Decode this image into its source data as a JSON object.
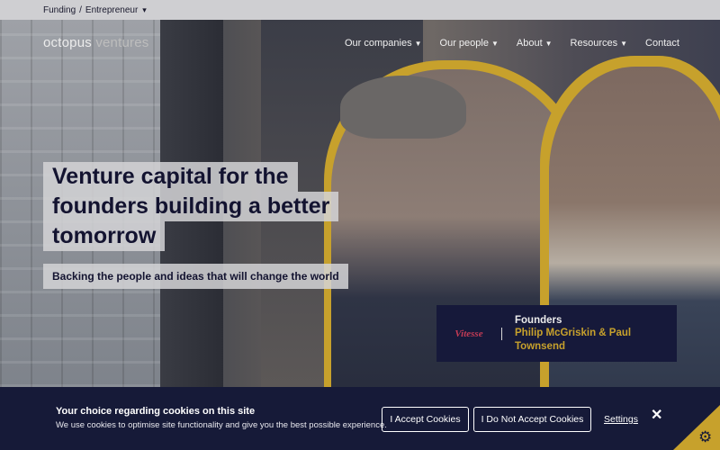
{
  "topbar": {
    "segment": "Funding",
    "separator": "/",
    "audience": "Entrepreneur",
    "chevron_icon": "chevron-down-icon"
  },
  "nav": {
    "logo_main": "octopus",
    "logo_sub": "ventures",
    "items": [
      {
        "label": "Our companies",
        "has_dropdown": true
      },
      {
        "label": "Our people",
        "has_dropdown": true
      },
      {
        "label": "About",
        "has_dropdown": true
      },
      {
        "label": "Resources",
        "has_dropdown": true
      },
      {
        "label": "Contact",
        "has_dropdown": false
      }
    ]
  },
  "hero": {
    "headline_lines": [
      "Venture capital for the",
      "founders building a better",
      "tomorrow"
    ],
    "subheadline": "Backing the people and ideas that will change the world"
  },
  "founders_card": {
    "company": "Vitesse",
    "label": "Founders",
    "names_line1": "Philip McGriskin & Paul",
    "names_line2": "Townsend"
  },
  "cookie_banner": {
    "title": "Your choice regarding cookies on this site",
    "body": "We use cookies to optimise site functionality and give you the best possible experience.",
    "accept_label": "I Accept Cookies",
    "reject_label": "I Do Not Accept Cookies",
    "settings_label": "Settings",
    "close_symbol": "✕",
    "settings_icon": "gear-icon"
  },
  "colors": {
    "navy": "#161a38",
    "gold": "#c7a12c",
    "headline_bg": "#d4d4d6",
    "brand_red": "#c23b55"
  }
}
